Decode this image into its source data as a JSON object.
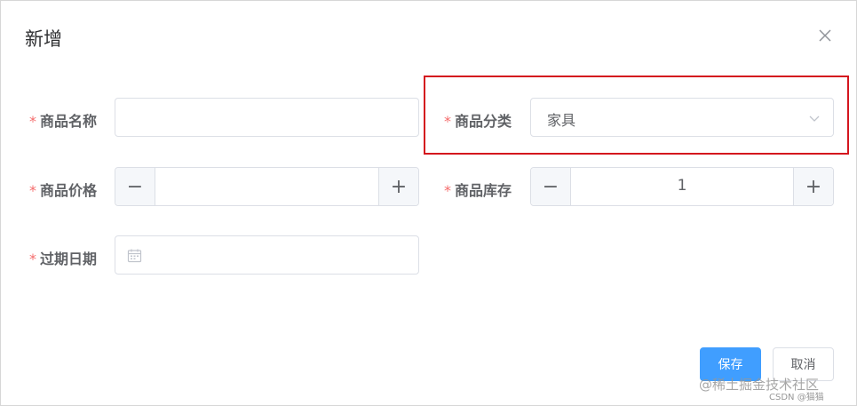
{
  "dialog": {
    "title": "新增",
    "close_icon": "close-icon"
  },
  "form": {
    "required_mark": "*",
    "product_name": {
      "label": "商品名称",
      "value": ""
    },
    "product_category": {
      "label": "商品分类",
      "value": "家具"
    },
    "product_price": {
      "label": "商品价格",
      "value": "",
      "minus": "−",
      "plus": "+"
    },
    "product_stock": {
      "label": "商品库存",
      "value": "1",
      "minus": "−",
      "plus": "+"
    },
    "expire_date": {
      "label": "过期日期",
      "value": "",
      "icon": "calendar-icon"
    }
  },
  "footer": {
    "save_label": "保存",
    "cancel_label": "取消"
  },
  "watermark": {
    "main": "@稀土掘金技术社区",
    "sub": "CSDN @猫猫"
  },
  "colors": {
    "primary": "#409eff",
    "required": "#f56c6c",
    "highlight": "#d4161e"
  }
}
